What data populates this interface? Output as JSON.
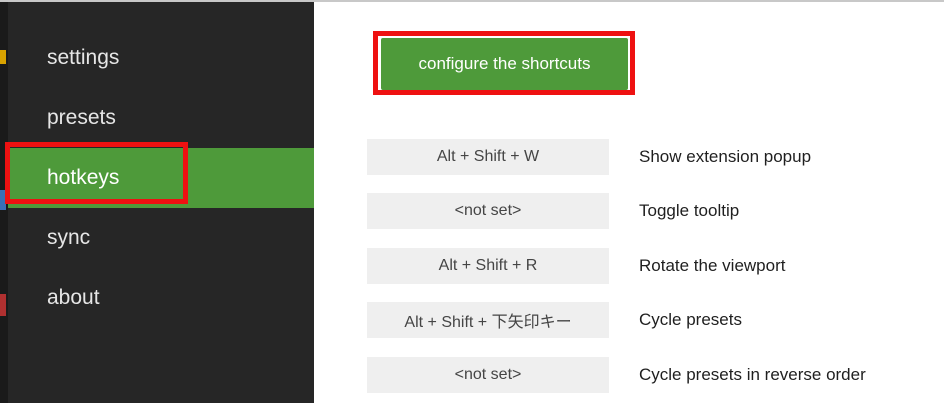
{
  "sidebar": {
    "items": [
      {
        "label": "settings"
      },
      {
        "label": "presets"
      },
      {
        "label": "hotkeys",
        "active": true
      },
      {
        "label": "sync"
      },
      {
        "label": "about"
      }
    ]
  },
  "main": {
    "configure_label": "configure the shortcuts",
    "shortcuts": [
      {
        "keys": "Alt + Shift + W",
        "command": "Show extension popup"
      },
      {
        "keys": "<not set>",
        "command": "Toggle tooltip"
      },
      {
        "keys": "Alt + Shift + R",
        "command": "Rotate the viewport"
      },
      {
        "keys": "Alt + Shift + 下矢印キー",
        "command": "Cycle presets"
      },
      {
        "keys": "<not set>",
        "command": "Cycle presets in reverse order"
      }
    ]
  },
  "colors": {
    "accent_green": "#4e9a3a",
    "sidebar_bg": "#262626",
    "highlight_red": "#ee1111",
    "shortcut_bg": "#efefef"
  }
}
